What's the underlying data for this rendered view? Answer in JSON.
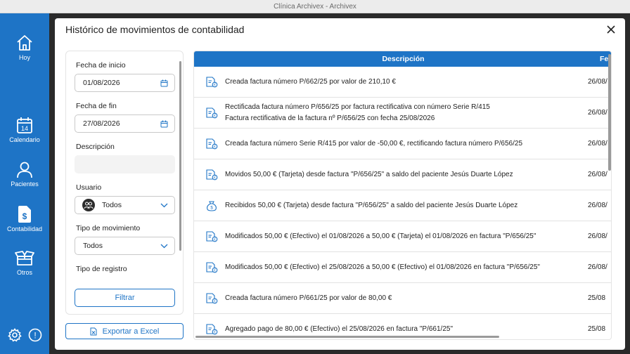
{
  "window": {
    "title": "Clínica Archivex - Archivex"
  },
  "sidebar": {
    "items": [
      {
        "label": "Hoy",
        "icon": "home-icon"
      },
      {
        "label": "Calendario",
        "icon": "calendar-icon",
        "day": "14"
      },
      {
        "label": "Pacientes",
        "icon": "user-icon"
      },
      {
        "label": "Contabilidad",
        "icon": "document-dollar-icon"
      },
      {
        "label": "Otros",
        "icon": "box-icon"
      }
    ],
    "bottom": [
      {
        "icon": "gear-icon"
      },
      {
        "icon": "alert-icon",
        "glyph": "!"
      }
    ]
  },
  "modal": {
    "title": "Histórico de movimientos de contabilidad",
    "filters": {
      "start_label": "Fecha de inicio",
      "start_value": "01/08/2026",
      "end_label": "Fecha de fin",
      "end_value": "27/08/2026",
      "desc_label": "Descripción",
      "desc_value": "",
      "user_label": "Usuario",
      "user_value": "Todos",
      "move_type_label": "Tipo de movimiento",
      "move_type_value": "Todos",
      "record_type_label": "Tipo de registro",
      "filter_button": "Filtrar"
    },
    "export_button": "Exportar a Excel",
    "table": {
      "columns": [
        "Descripción",
        "Fe"
      ],
      "rows": [
        {
          "icon": "invoice-icon",
          "line1": "Creada factura número P/662/25 por valor de 210,10 €",
          "line2": "",
          "date": "26/08/"
        },
        {
          "icon": "invoice-icon",
          "line1": "Rectificada factura número P/656/25 por factura rectificativa con número Serie R/415",
          "line2": "Factura rectificativa de la factura nº P/656/25 con fecha 25/08/2026",
          "date": "26/08/"
        },
        {
          "icon": "invoice-icon",
          "line1": "Creada factura número Serie R/415 por valor de -50,00 €, rectificando factura número P/656/25",
          "line2": "",
          "date": "26/08/"
        },
        {
          "icon": "invoice-icon",
          "line1": "Movidos 50,00 € (Tarjeta) desde factura \"P/656/25\" a saldo del paciente Jesús Duarte López",
          "line2": "",
          "date": "26/08/"
        },
        {
          "icon": "money-bag-icon",
          "line1": "Recibidos 50,00 € (Tarjeta) desde factura \"P/656/25\" a saldo del paciente Jesús Duarte López",
          "line2": "",
          "date": "26/08/"
        },
        {
          "icon": "invoice-icon",
          "line1": "Modificados 50,00 € (Efectivo) el 01/08/2026 a 50,00 € (Tarjeta) el 01/08/2026 en factura \"P/656/25\"",
          "line2": "",
          "date": "26/08/"
        },
        {
          "icon": "invoice-icon",
          "line1": "Modificados 50,00 € (Efectivo) el 25/08/2026 a 50,00 € (Efectivo) el 01/08/2026 en factura \"P/656/25\"",
          "line2": "",
          "date": "26/08/"
        },
        {
          "icon": "invoice-icon",
          "line1": "Creada factura número P/661/25 por valor de 80,00 €",
          "line2": "",
          "date": "25/08"
        },
        {
          "icon": "invoice-icon",
          "line1": "Agregado pago de 80,00 € (Efectivo) el 25/08/2026 en factura \"P/661/25\"",
          "line2": "",
          "date": "25/08"
        }
      ]
    }
  },
  "colors": {
    "accent": "#1e74c6",
    "overlay": "#2a2a2a",
    "titlebar": "#ececec"
  }
}
